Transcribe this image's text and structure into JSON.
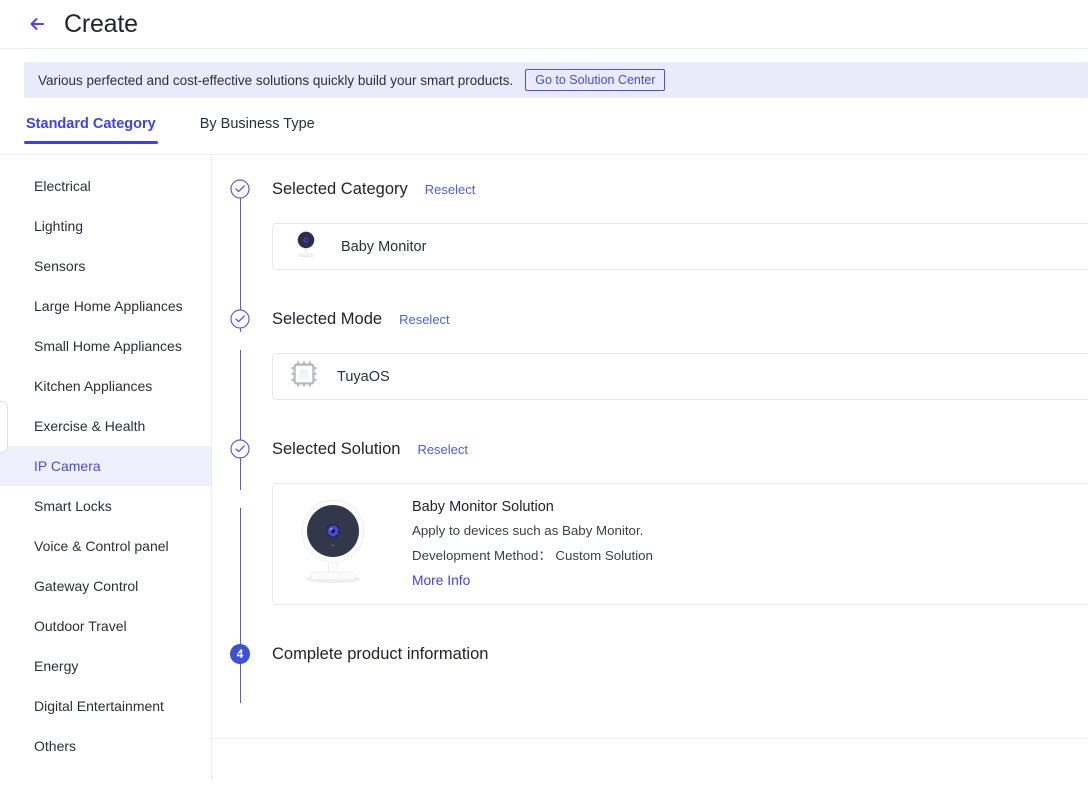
{
  "header": {
    "title": "Create",
    "back_icon": "arrow-left-icon"
  },
  "banner": {
    "text": "Various perfected and cost-effective solutions quickly build your smart products.",
    "button_label": "Go to Solution Center"
  },
  "tabs": [
    {
      "label": "Standard Category",
      "active": true
    },
    {
      "label": "By Business Type",
      "active": false
    }
  ],
  "sidebar": {
    "items": [
      {
        "label": "Electrical",
        "active": false
      },
      {
        "label": "Lighting",
        "active": false
      },
      {
        "label": "Sensors",
        "active": false
      },
      {
        "label": "Large Home Appliances",
        "active": false
      },
      {
        "label": "Small Home Appliances",
        "active": false
      },
      {
        "label": "Kitchen Appliances",
        "active": false
      },
      {
        "label": "Exercise & Health",
        "active": false
      },
      {
        "label": "IP Camera",
        "active": true
      },
      {
        "label": "Smart Locks",
        "active": false
      },
      {
        "label": "Voice & Control panel",
        "active": false
      },
      {
        "label": "Gateway Control",
        "active": false
      },
      {
        "label": "Outdoor Travel",
        "active": false
      },
      {
        "label": "Energy",
        "active": false
      },
      {
        "label": "Digital Entertainment",
        "active": false
      },
      {
        "label": "Others",
        "active": false
      }
    ]
  },
  "steps": {
    "category": {
      "title": "Selected Category",
      "reselect_label": "Reselect",
      "marker": "check-circle-icon",
      "item_label": "Baby Monitor",
      "item_icon": "camera-icon"
    },
    "mode": {
      "title": "Selected Mode",
      "reselect_label": "Reselect",
      "marker": "check-circle-icon",
      "item_label": "TuyaOS",
      "item_icon": "chip-icon"
    },
    "solution": {
      "title": "Selected Solution",
      "reselect_label": "Reselect",
      "marker": "check-circle-icon",
      "item_icon": "camera-icon",
      "name": "Baby Monitor Solution",
      "description": "Apply to devices such as Baby Monitor.",
      "development_method": "Development Method：  Custom Solution",
      "more_info_label": "More Info"
    },
    "complete": {
      "number": "4",
      "title": "Complete product information"
    }
  },
  "colors": {
    "accent": "#3f3ff0",
    "link": "#4a5ee6",
    "banner_bg": "#e9ebfb",
    "sidebar_active_bg": "#eef0fd",
    "step_num_bg": "#3f50d8"
  }
}
